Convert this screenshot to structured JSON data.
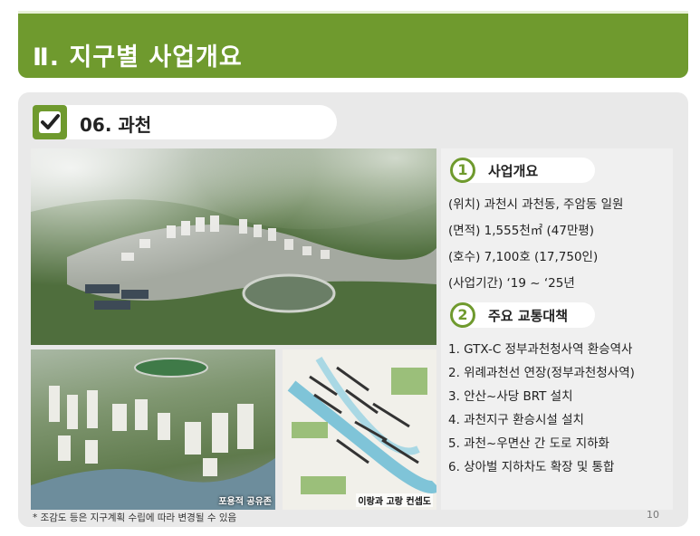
{
  "header": {
    "title": "Ⅱ. 지구별 사업개요"
  },
  "section": {
    "title": "06. 과천"
  },
  "images": {
    "left_caption": "포용적 공유존",
    "right_caption": "이랑과 고랑 컨셉도"
  },
  "overview": {
    "number": "1",
    "label": "사업개요",
    "lines": [
      "(위치) 과천시 과천동, 주암동 일원",
      "(면적) 1,555천㎡ (47만평)",
      "(호수) 7,100호 (17,750인)",
      "(사업기간) ‘19 ~ ‘25년"
    ]
  },
  "transport": {
    "number": "2",
    "label": "주요 교통대책",
    "lines": [
      "1. GTX-C 정부과천청사역 환승역사",
      "2. 위례과천선 연장(정부과천청사역)",
      "3. 안산~사당 BRT 설치",
      "4. 과천지구 환승시설 설치",
      "5. 과천~우면산 간 도로 지하화",
      "6. 상아벌 지하차도 확장 및 통합"
    ]
  },
  "footer": {
    "note": "* 조감도 등은 지구계획 수립에 따라 변경될 수 있음",
    "page": "10"
  },
  "colors": {
    "accent": "#6f9a2e",
    "panel": "#e9e9e9"
  },
  "icons": {
    "section": "check-icon"
  }
}
